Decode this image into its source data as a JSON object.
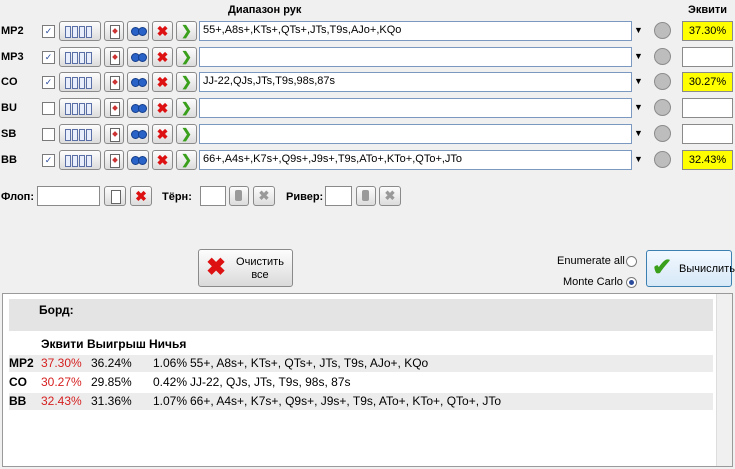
{
  "header": {
    "range_title": "Диапазон рук",
    "equity_title": "Эквити"
  },
  "players": [
    {
      "pos": "MP2",
      "checked": true,
      "range": "55+,A8s+,KTs+,QTs+,JTs,T9s,AJo+,KQo",
      "equity": "37.30%",
      "highlight": true
    },
    {
      "pos": "MP3",
      "checked": true,
      "range": "",
      "equity": "",
      "highlight": false
    },
    {
      "pos": "CO",
      "checked": true,
      "range": "JJ-22,QJs,JTs,T9s,98s,87s",
      "equity": "30.27%",
      "highlight": true
    },
    {
      "pos": "BU",
      "checked": false,
      "range": "",
      "equity": "",
      "highlight": false
    },
    {
      "pos": "SB",
      "checked": false,
      "range": "",
      "equity": "",
      "highlight": false
    },
    {
      "pos": "BB",
      "checked": true,
      "range": "66+,A4s+,K7s+,Q9s+,J9s+,T9s,ATo+,KTo+,QTo+,JTo",
      "equity": "32.43%",
      "highlight": true
    }
  ],
  "board": {
    "flop_label": "Флоп:",
    "turn_label": "Тёрн:",
    "river_label": "Ривер:"
  },
  "actions": {
    "clear_label": "Очистить все",
    "enumerate_label": "Enumerate all",
    "montecarlo_label": "Monte Carlo",
    "calc_label": "Вычислить",
    "mode": "Monte Carlo"
  },
  "colors": {
    "highlight": "#ffff00",
    "equity_text": "#d61f1f"
  },
  "results": {
    "board_label": "Борд:",
    "columns": [
      "Эквити",
      "Выигрыш",
      "Ничья"
    ],
    "rows": [
      {
        "pos": "MP2",
        "equity": "37.30%",
        "win": "36.24%",
        "tie": "1.06%",
        "hand": "55+, A8s+, KTs+, QTs+, JTs, T9s, AJo+, KQo"
      },
      {
        "pos": "CO",
        "equity": "30.27%",
        "win": "29.85%",
        "tie": "0.42%",
        "hand": "JJ-22, QJs, JTs, T9s, 98s, 87s"
      },
      {
        "pos": "BB",
        "equity": "32.43%",
        "win": "31.36%",
        "tie": "1.07%",
        "hand": "66+, A4s+, K7s+, Q9s+, J9s+, T9s, ATo+, KTo+, QTo+, JTo"
      }
    ]
  }
}
